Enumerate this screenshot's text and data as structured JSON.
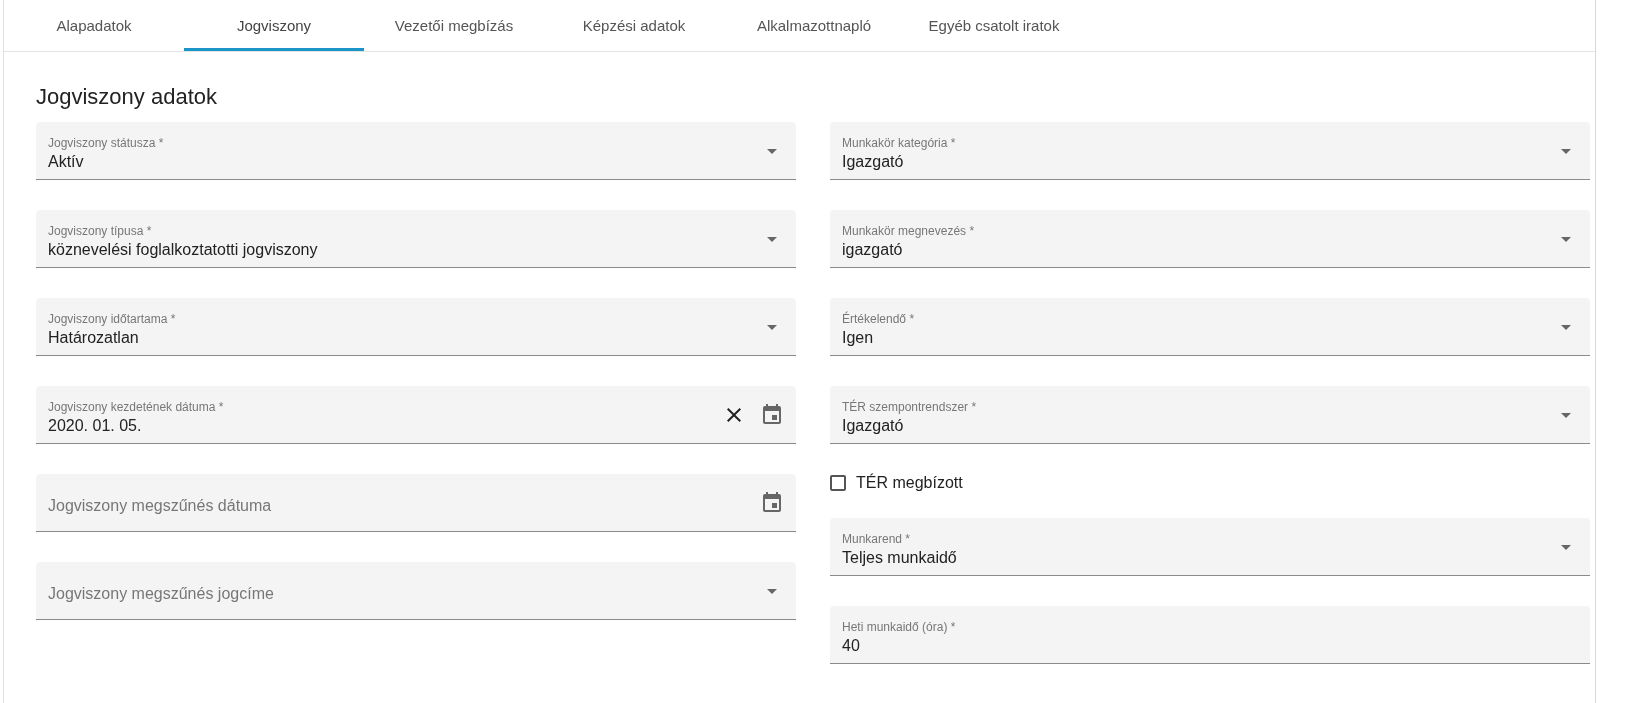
{
  "tabs": [
    {
      "label": "Alapadatok",
      "selected": false
    },
    {
      "label": "Jogviszony",
      "selected": true
    },
    {
      "label": "Vezetői megbízás",
      "selected": false
    },
    {
      "label": "Képzési adatok",
      "selected": false
    },
    {
      "label": "Alkalmazottnapló",
      "selected": false
    },
    {
      "label": "Egyéb csatolt iratok",
      "selected": false
    }
  ],
  "section_title": "Jogviszony adatok",
  "left_fields": [
    {
      "kind": "select",
      "label": "Jogviszony státusza *",
      "value": "Aktív"
    },
    {
      "kind": "select",
      "label": "Jogviszony típusa *",
      "value": "köznevelési foglalkoztatotti jogviszony"
    },
    {
      "kind": "select",
      "label": "Jogviszony időtartama *",
      "value": "Határozatlan"
    },
    {
      "kind": "date",
      "label": "Jogviszony kezdetének dátuma *",
      "value": "2020. 01. 05."
    },
    {
      "kind": "date",
      "placeholder": "Jogviszony megszűnés dátuma"
    },
    {
      "kind": "select",
      "placeholder": "Jogviszony megszűnés jogcíme"
    }
  ],
  "right_fields": [
    {
      "kind": "select",
      "label": "Munkakör kategória *",
      "value": "Igazgató"
    },
    {
      "kind": "select",
      "label": "Munkakör megnevezés *",
      "value": "igazgató"
    },
    {
      "kind": "select",
      "label": "Értékelendő *",
      "value": "Igen"
    },
    {
      "kind": "select",
      "label": "TÉR szempontrendszer *",
      "value": "Igazgató"
    },
    {
      "kind": "checkbox",
      "label": "TÉR megbízott",
      "checked": false
    },
    {
      "kind": "select",
      "label": "Munkarend *",
      "value": "Teljes munkaidő"
    },
    {
      "kind": "text",
      "label": "Heti munkaidő (óra) *",
      "value": "40"
    }
  ]
}
